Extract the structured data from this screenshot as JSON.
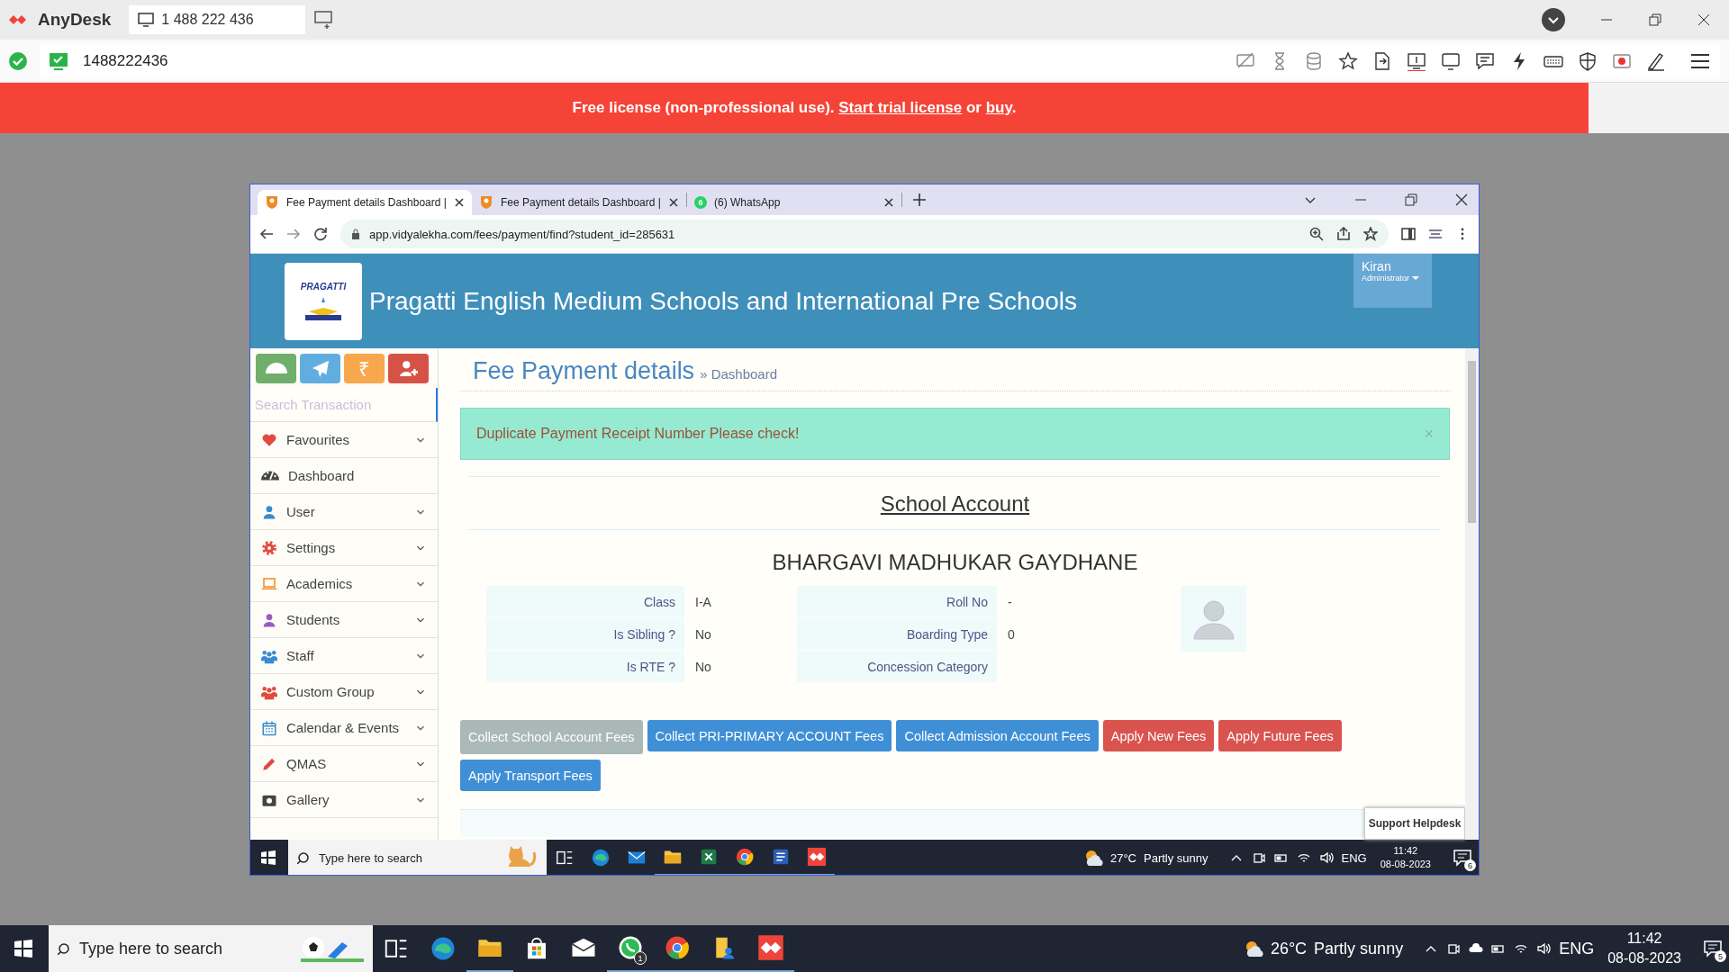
{
  "anydesk": {
    "app_name": "AnyDesk",
    "session_tab": "1 488 222 436",
    "address": "1488222436",
    "connected": true,
    "banner": [
      {
        "kind": "text",
        "text": "Free license (non-professional use). "
      },
      {
        "kind": "link",
        "text": "Start trial license"
      },
      {
        "kind": "text",
        "text": " or "
      },
      {
        "kind": "link",
        "text": "buy"
      },
      {
        "kind": "text",
        "text": "."
      }
    ]
  },
  "browser": {
    "tabs": [
      {
        "title": "Fee Payment details Dashboard |",
        "kind": "school",
        "selected": true
      },
      {
        "title": "Fee Payment details Dashboard |",
        "kind": "school",
        "selected": false
      },
      {
        "title": "(6) WhatsApp",
        "kind": "whatsapp",
        "badge": "6",
        "selected": false
      }
    ],
    "url": "app.vidyalekha.com/fees/payment/find?student_id=285631"
  },
  "app": {
    "logo_text": "PRAGATTI",
    "school_name": "Pragatti English Medium Schools and International Pre Schools",
    "user": {
      "name": "Kiran",
      "role": "Administrator"
    },
    "quick_buttons": [
      {
        "kind": "dashboard",
        "color": "#6fae6b"
      },
      {
        "kind": "send",
        "color": "#62ade0"
      },
      {
        "kind": "rupee",
        "color": "#f7a84c",
        "glyph": "₹"
      },
      {
        "kind": "add-user",
        "color": "#d65247"
      }
    ],
    "search": {
      "placeholder": "Search Transaction"
    },
    "menu": [
      {
        "label": "Favourites",
        "kind": "heart",
        "expandable": true
      },
      {
        "label": "Dashboard",
        "kind": "gauge",
        "expandable": false
      },
      {
        "label": "User",
        "kind": "user",
        "expandable": true
      },
      {
        "label": "Settings",
        "kind": "gear",
        "expandable": true
      },
      {
        "label": "Academics",
        "kind": "laptop",
        "expandable": true
      },
      {
        "label": "Students",
        "kind": "student",
        "expandable": true
      },
      {
        "label": "Staff",
        "kind": "staff",
        "expandable": true
      },
      {
        "label": "Custom Group",
        "kind": "group",
        "expandable": true
      },
      {
        "label": "Calendar & Events",
        "kind": "calendar",
        "expandable": true
      },
      {
        "label": "QMAS",
        "kind": "pencil",
        "expandable": true
      },
      {
        "label": "Gallery",
        "kind": "camera",
        "expandable": true
      }
    ],
    "page_title": "Fee Payment details",
    "breadcrumb": "» Dashboard",
    "alert": {
      "text": "Duplicate Payment Receipt Number Please check!",
      "close": "×"
    },
    "account_title": "School Account",
    "student_name": "BHARGAVI MADHUKAR GAYDHANE",
    "details_left": [
      {
        "label": "Class",
        "value": "I-A"
      },
      {
        "label": "Is Sibling ?",
        "value": "No"
      },
      {
        "label": "Is RTE ?",
        "value": "No"
      }
    ],
    "details_right": [
      {
        "label": "Roll No",
        "value": "-"
      },
      {
        "label": "Boarding Type",
        "value": "0"
      },
      {
        "label": "Concession Category"
      }
    ],
    "fee_buttons": [
      {
        "label": "Collect School Account Fees",
        "kind": "default",
        "disabled": true
      },
      {
        "label": "Collect PRI-PRIMARY ACCOUNT Fees",
        "kind": "primary",
        "disabled": false
      },
      {
        "label": "Collect Admission Account Fees",
        "kind": "primary",
        "disabled": false
      },
      {
        "label": "Apply New Fees",
        "kind": "danger",
        "disabled": false
      },
      {
        "label": "Apply Future Fees",
        "kind": "danger",
        "disabled": false
      },
      {
        "label": "Apply Transport Fees",
        "kind": "primary",
        "disabled": false
      }
    ],
    "support": "Support Helpdesk"
  },
  "remote_taskbar": {
    "search_placeholder": "Type here to search",
    "temperature": "27°C",
    "weather": "Partly sunny",
    "language": "ENG",
    "time": "11:42",
    "date": "08-08-2023",
    "notifications": "6"
  },
  "local_taskbar": {
    "search_placeholder": "Type here to search",
    "temperature": "26°C",
    "weather": "Partly sunny",
    "language": "ENG",
    "time": "11:42",
    "date": "08-08-2023",
    "notifications": "5",
    "whatsapp_badge": "1"
  }
}
